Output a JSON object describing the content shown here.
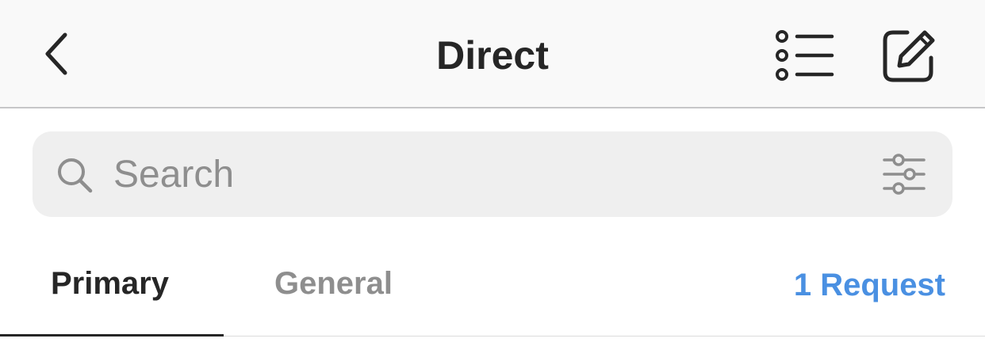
{
  "header": {
    "title": "Direct",
    "back_icon": "chevron-left-icon",
    "list_icon": "list-icon",
    "compose_icon": "compose-icon"
  },
  "search": {
    "placeholder": "Search",
    "value": "",
    "search_icon": "search-icon",
    "filter_icon": "filter-icon"
  },
  "tabs": {
    "items": [
      {
        "label": "Primary",
        "active": true
      },
      {
        "label": "General",
        "active": false
      }
    ],
    "requests_label": "1 Request"
  },
  "colors": {
    "text_primary": "#262626",
    "text_secondary": "#8e8e8e",
    "accent": "#4a90e2",
    "header_bg": "#f9f9f9",
    "search_bg": "#efefef"
  }
}
